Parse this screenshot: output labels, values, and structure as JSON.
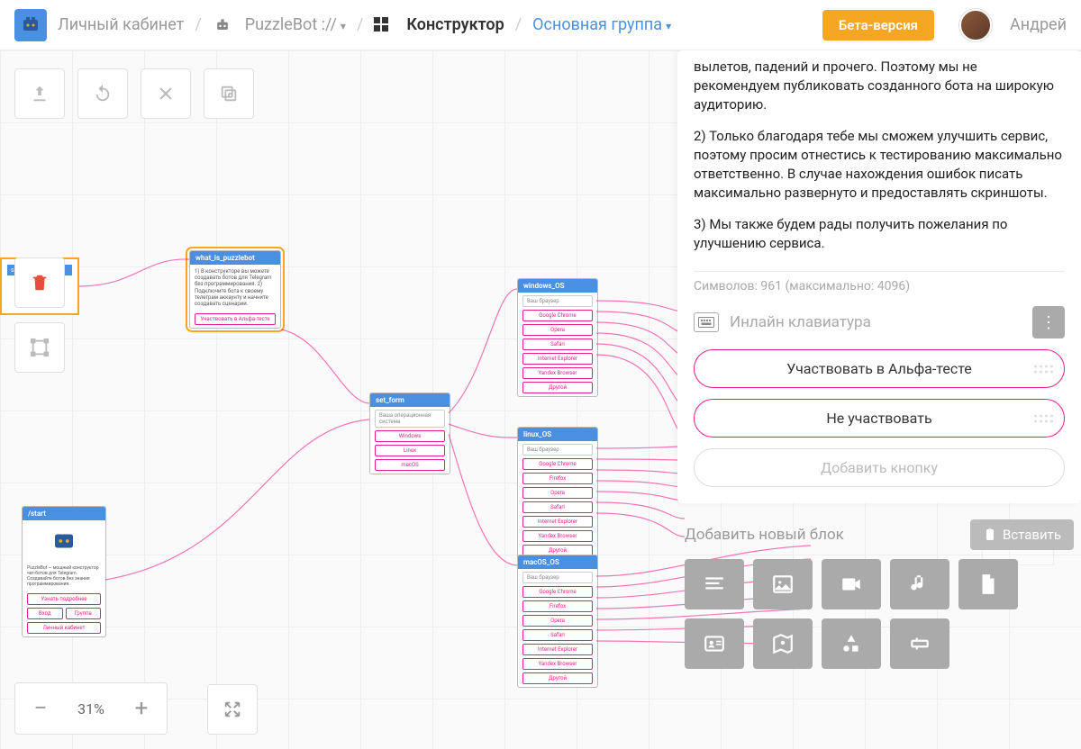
{
  "topbar": {
    "dashboard": "Личный кабинет",
    "bot_name": "PuzzleBot ://",
    "constructor": "Конструктор",
    "group": "Основная группа",
    "beta": "Бета-версия",
    "username": "Андрей"
  },
  "zoom": {
    "value": "31%"
  },
  "nodes": {
    "what_is": {
      "title": "what_is_puzzlebot",
      "body": "1) В конструкторе вы можете создавать ботов для Telegram без программирования.\n2) Подключите бота к своему телеграм аккаунту и начните создавать сценарии.",
      "btn1": "Участвовать в Альфа-тесте"
    },
    "start": {
      "title": "/start",
      "btn1": "Узнать подробнее",
      "btn2": "Вход",
      "btn3": "Группа",
      "btn4": "Личный кабинет"
    },
    "set_form": {
      "title": "set_form",
      "input": "Ваша операционная система",
      "opt1": "Windows",
      "opt2": "Linux",
      "opt3": "macOS"
    },
    "windows": {
      "title": "windows_OS",
      "input": "Ваш браузер",
      "opts": [
        "Google Chrome",
        "Opera",
        "Safari",
        "Internet Explorer",
        "Yandex Browser",
        "Другой"
      ]
    },
    "linux": {
      "title": "linux_OS",
      "input": "Ваш браузер",
      "opts": [
        "Google Chrome",
        "Firefox",
        "Opera",
        "Safari",
        "Internet Explorer",
        "Yandex Browser",
        "Другой"
      ]
    },
    "macos": {
      "title": "macOS_OS",
      "input": "Ваш браузер",
      "opts": [
        "Google Chrome",
        "Firefox",
        "Opera",
        "Safari",
        "Internet Explorer",
        "Yandex Browser",
        "Другой"
      ]
    }
  },
  "panel": {
    "text_p1": "вылетов, падений и прочего. Поэтому мы не рекомендуем публиковать созданного бота на широкую аудиторию.",
    "text_p2": "2) Только благодаря тебе мы сможем улучшить сервис, поэтому просим отнестись к тестированию максимально ответственно. В случае нахождения ошибок писать максимально развернуто и предоставлять скриншоты.",
    "text_p3": "3) Мы также будем рады получить пожелания по улучшению сервиса.",
    "charcount": "Символов: 961 (максимально: 4096)",
    "keyboard_label": "Инлайн клавиатура",
    "btn1": "Участвовать в Альфа-тесте",
    "btn2": "Не участвовать",
    "btn_add": "Добавить кнопку",
    "add_block": "Добавить новый блок",
    "paste": "Вставить"
  }
}
